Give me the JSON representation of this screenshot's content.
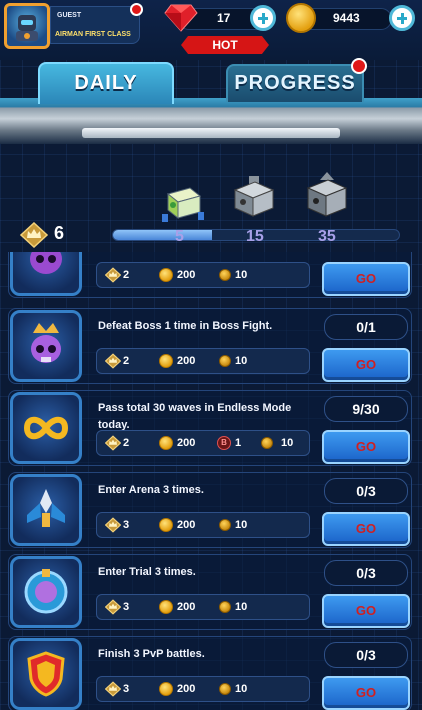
{
  "player": {
    "name": "GUEST",
    "rank": "AIRMAN FIRST CLASS"
  },
  "resources": {
    "gems": "17",
    "coins": "9443"
  },
  "hot_label": "HOT",
  "tabs": [
    {
      "label": "DAILY",
      "active": true
    },
    {
      "label": "PROGRESS",
      "active": false,
      "notification": true
    }
  ],
  "activity": {
    "points": "6",
    "progress_fraction": 0.345,
    "milestones": [
      "5",
      "15",
      "35"
    ]
  },
  "tasks": [
    {
      "description": "",
      "rewards": {
        "crown": "2",
        "coin": "200",
        "medal": "10"
      },
      "go_label": "GO",
      "icon": "skull-icon"
    },
    {
      "description": "Defeat Boss 1 time in Boss Fight.",
      "progress": "0/1",
      "rewards": {
        "crown": "2",
        "coin": "200",
        "medal": "10"
      },
      "go_label": "GO",
      "icon": "skull-crown-icon"
    },
    {
      "description": "Pass total 30 waves in Endless Mode today.",
      "progress": "9/30",
      "rewards": {
        "crown": "2",
        "coin": "200",
        "b_token": "1",
        "medal": "10"
      },
      "go_label": "GO",
      "icon": "infinity-icon"
    },
    {
      "description": "Enter Arena 3 times.",
      "progress": "0/3",
      "rewards": {
        "crown": "3",
        "coin": "200",
        "medal": "10"
      },
      "go_label": "GO",
      "icon": "spaceship-icon"
    },
    {
      "description": "Enter Trial 3 times.",
      "progress": "0/3",
      "rewards": {
        "crown": "3",
        "coin": "200",
        "medal": "10"
      },
      "go_label": "GO",
      "icon": "trial-emblem-icon"
    },
    {
      "description": "Finish 3 PvP battles.",
      "progress": "0/3",
      "rewards": {
        "crown": "3",
        "coin": "200",
        "medal": "10"
      },
      "go_label": "GO",
      "icon": "shield-icon"
    }
  ]
}
